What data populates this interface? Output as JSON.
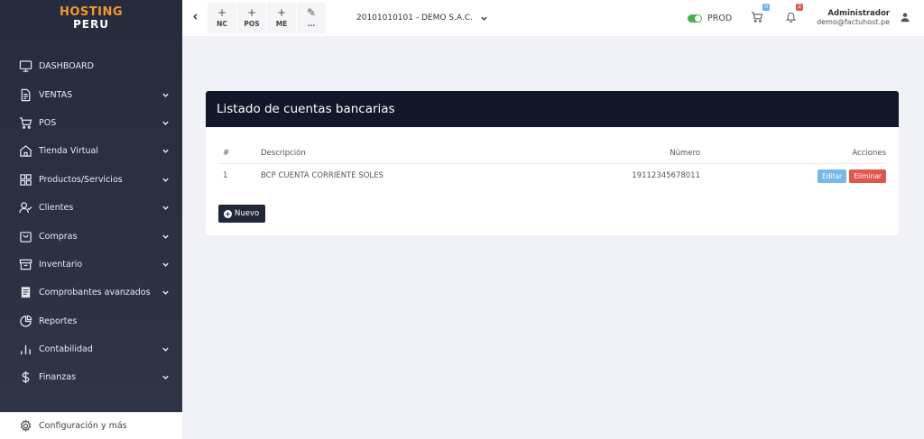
{
  "logo": {
    "line1": "HOSTING",
    "line2": "PERU"
  },
  "sidebar": {
    "items": [
      {
        "label": "DASHBOARD",
        "icon": "monitor-icon",
        "has_children": false
      },
      {
        "label": "VENTAS",
        "icon": "document-icon",
        "has_children": true
      },
      {
        "label": "POS",
        "icon": "cart-icon",
        "has_children": true
      },
      {
        "label": "Tienda Virtual",
        "icon": "store-icon",
        "has_children": true
      },
      {
        "label": "Productos/Servicios",
        "icon": "grid-icon",
        "has_children": true
      },
      {
        "label": "Clientes",
        "icon": "user-check-icon",
        "has_children": true
      },
      {
        "label": "Compras",
        "icon": "bag-icon",
        "has_children": true
      },
      {
        "label": "Inventario",
        "icon": "archive-icon",
        "has_children": true
      },
      {
        "label": "Comprobantes avanzados",
        "icon": "receipt-icon",
        "has_children": true
      },
      {
        "label": "Reportes",
        "icon": "pie-chart-icon",
        "has_children": false
      },
      {
        "label": "Contabilidad",
        "icon": "bar-chart-icon",
        "has_children": true
      },
      {
        "label": "Finanzas",
        "icon": "dollar-icon",
        "has_children": true
      }
    ],
    "footer": {
      "label": "Configuración y más",
      "icon": "gear-icon"
    }
  },
  "header": {
    "quick_actions": [
      {
        "label": "NC",
        "symbol": "+"
      },
      {
        "label": "POS",
        "symbol": "+"
      },
      {
        "label": "ME",
        "symbol": "+"
      },
      {
        "label": "...",
        "symbol": "✎"
      }
    ],
    "company": "20101010101 - DEMO S.A.C.",
    "env_label": "PROD",
    "cart_badge": "0",
    "notif_badge": "2",
    "user_name": "Administrador",
    "user_email": "demo@factuhost.pe"
  },
  "card": {
    "title": "Listado de cuentas bancarias",
    "columns": [
      "#",
      "Descripción",
      "Número",
      "Acciones"
    ],
    "rows": [
      {
        "num": "1",
        "description": "BCP CUENTA CORRIENTE SOLES",
        "number": "19112345678011",
        "edit_label": "Editar",
        "delete_label": "Eliminar"
      }
    ],
    "new_button": "Nuevo"
  },
  "colors": {
    "sidebar_bg": "#2b3042",
    "card_header": "#121829",
    "logo_accent": "#f39a2b",
    "edit": "#76b8ea",
    "delete": "#e0574d",
    "toggle_on": "#4caf50"
  }
}
